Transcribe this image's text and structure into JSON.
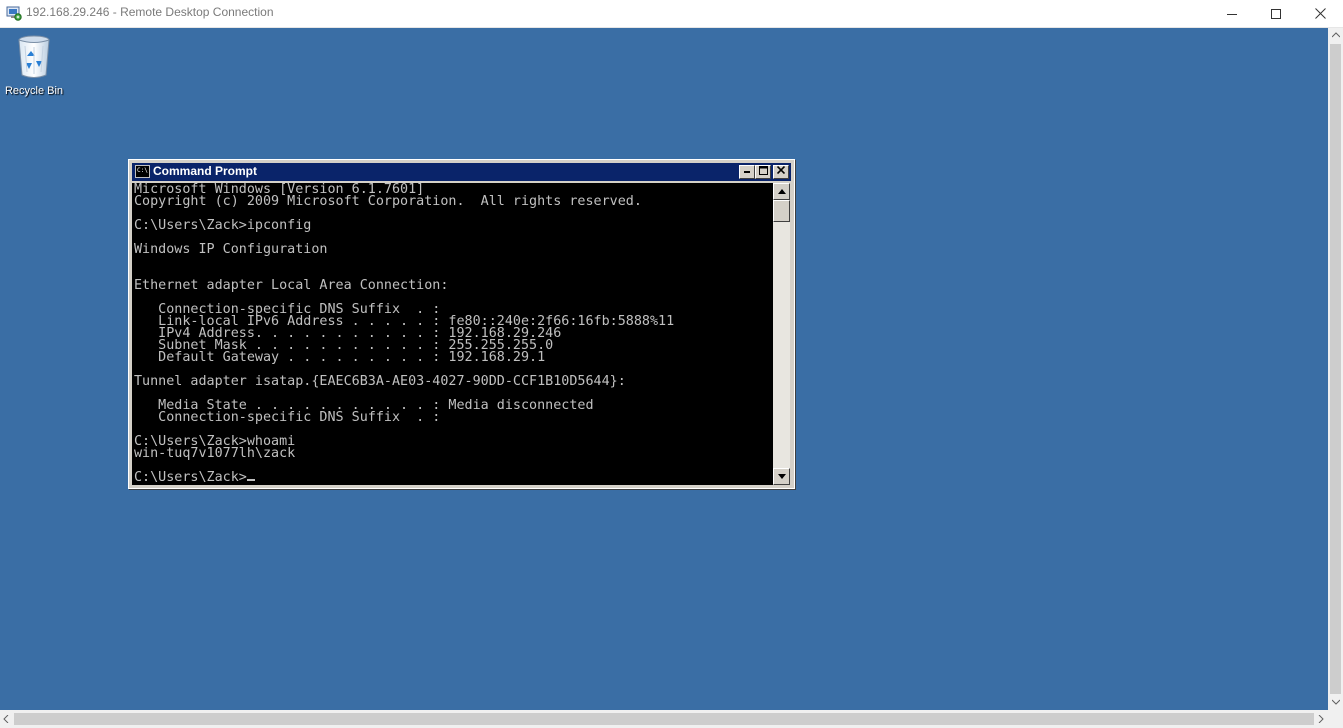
{
  "rdp_window": {
    "title": "192.168.29.246 - Remote Desktop Connection",
    "controls": {
      "minimize": "—",
      "maximize": "☐",
      "close": "✕"
    }
  },
  "desktop": {
    "background_color": "#3a6ea5",
    "icons": [
      {
        "label": "Recycle Bin",
        "icon": "recycle-bin-icon"
      }
    ]
  },
  "cmd_window": {
    "title": "Command Prompt",
    "controls": {
      "minimize": "_",
      "maximize": "□",
      "close": "✕"
    },
    "lines": [
      "Microsoft Windows [Version 6.1.7601]",
      "Copyright (c) 2009 Microsoft Corporation.  All rights reserved.",
      "",
      "C:\\Users\\Zack>ipconfig",
      "",
      "Windows IP Configuration",
      "",
      "",
      "Ethernet adapter Local Area Connection:",
      "",
      "   Connection-specific DNS Suffix  . :",
      "   Link-local IPv6 Address . . . . . : fe80::240e:2f66:16fb:5888%11",
      "   IPv4 Address. . . . . . . . . . . : 192.168.29.246",
      "   Subnet Mask . . . . . . . . . . . : 255.255.255.0",
      "   Default Gateway . . . . . . . . . : 192.168.29.1",
      "",
      "Tunnel adapter isatap.{EAEC6B3A-AE03-4027-90DD-CCF1B10D5644}:",
      "",
      "   Media State . . . . . . . . . . . : Media disconnected",
      "   Connection-specific DNS Suffix  . :",
      "",
      "C:\\Users\\Zack>whoami",
      "win-tuq7v1077lh\\zack",
      ""
    ],
    "prompt": "C:\\Users\\Zack>"
  }
}
